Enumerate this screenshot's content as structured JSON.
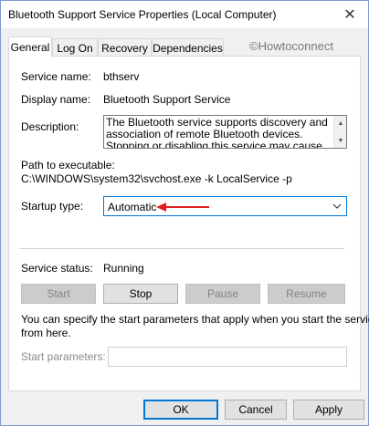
{
  "window": {
    "title": "Bluetooth Support Service Properties (Local Computer)",
    "close_glyph": "✕"
  },
  "tabs": [
    {
      "label": "General",
      "active": true
    },
    {
      "label": "Log On",
      "active": false
    },
    {
      "label": "Recovery",
      "active": false
    },
    {
      "label": "Dependencies",
      "active": false
    }
  ],
  "watermark": "©Howtoconnect",
  "general": {
    "service_name_label": "Service name:",
    "service_name_value": "bthserv",
    "display_name_label": "Display name:",
    "display_name_value": "Bluetooth Support Service",
    "description_label": "Description:",
    "description_value": "The Bluetooth service supports discovery and association of remote Bluetooth devices.  Stopping or disabling this service may cause already installed",
    "path_label": "Path to executable:",
    "path_value": "C:\\WINDOWS\\system32\\svchost.exe -k LocalService -p",
    "startup_type_label": "Startup type:",
    "startup_type_value": "Automatic",
    "service_status_label": "Service status:",
    "service_status_value": "Running",
    "buttons": {
      "start": "Start",
      "stop": "Stop",
      "pause": "Pause",
      "resume": "Resume"
    },
    "hint_text_line1": "You can specify the start parameters that apply when you start the service",
    "hint_text_line2": "from here.",
    "start_params_label": "Start parameters:",
    "start_params_value": ""
  },
  "footer": {
    "ok": "OK",
    "cancel": "Cancel",
    "apply": "Apply"
  },
  "colors": {
    "accent": "#0078d7",
    "annotation_arrow": "#e02020"
  }
}
